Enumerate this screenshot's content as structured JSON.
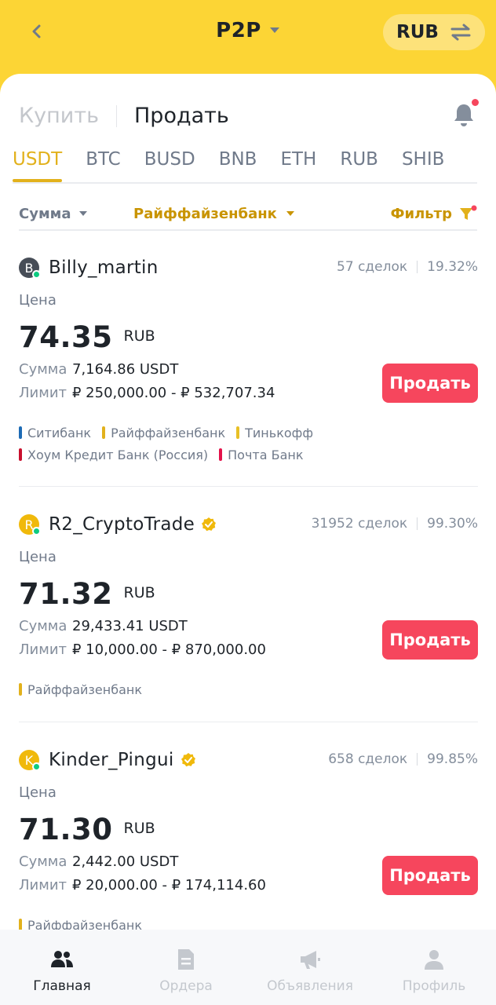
{
  "header": {
    "title": "P2P",
    "currency": "RUB"
  },
  "trade_tabs": {
    "buy": "Купить",
    "sell": "Продать"
  },
  "coins": [
    "USDT",
    "BTC",
    "BUSD",
    "BNB",
    "ETH",
    "RUB",
    "SHIB"
  ],
  "filters": {
    "amount": "Сумма",
    "bank": "Райффайзенбанк",
    "filter": "Фильтр"
  },
  "labels": {
    "price": "Цена",
    "amount": "Сумма",
    "limit": "Лимит",
    "sell_button": "Продать"
  },
  "colors": {
    "brand": "#fcd535",
    "accent": "#e2b11c",
    "sell": "#f6465d",
    "online": "#0ecb81"
  },
  "ads": [
    {
      "name": "Billy_martin",
      "initial": "B",
      "avatar_color": "#474d57",
      "verified": false,
      "trades": "57 сделок",
      "completion": "19.32%",
      "price": "74.35",
      "currency": "RUB",
      "amount": "7,164.86 USDT",
      "limit": "₽ 250,000.00 - ₽ 532,707.34",
      "payments": [
        {
          "name": "Ситибанк",
          "color": "#1c6bb5"
        },
        {
          "name": "Райффайзенбанк",
          "color": "#e2b11c"
        },
        {
          "name": "Тинькофф",
          "color": "#e8c026"
        },
        {
          "name": "Хоум Кредит Банк (Россия)",
          "color": "#c8102e"
        },
        {
          "name": "Почта Банк",
          "color": "#e3124a"
        }
      ]
    },
    {
      "name": "R2_CryptoTrade",
      "initial": "R",
      "avatar_color": "#f0b90b",
      "verified": true,
      "trades": "31952 сделок",
      "completion": "99.30%",
      "price": "71.32",
      "currency": "RUB",
      "amount": "29,433.41 USDT",
      "limit": "₽ 10,000.00 - ₽ 870,000.00",
      "payments": [
        {
          "name": "Райффайзенбанк",
          "color": "#e2b11c"
        }
      ]
    },
    {
      "name": "Kinder_Pingui",
      "initial": "K",
      "avatar_color": "#f0b90b",
      "verified": true,
      "trades": "658 сделок",
      "completion": "99.85%",
      "price": "71.30",
      "currency": "RUB",
      "amount": "2,442.00 USDT",
      "limit": "₽ 20,000.00 - ₽ 174,114.60",
      "payments": [
        {
          "name": "Райффайзенбанк",
          "color": "#e2b11c"
        }
      ]
    }
  ],
  "nav": [
    {
      "label": "Главная",
      "icon": "home-people-icon",
      "active": true
    },
    {
      "label": "Ордера",
      "icon": "orders-icon",
      "active": false
    },
    {
      "label": "Объявления",
      "icon": "megaphone-icon",
      "active": false
    },
    {
      "label": "Профиль",
      "icon": "profile-icon",
      "active": false
    }
  ]
}
